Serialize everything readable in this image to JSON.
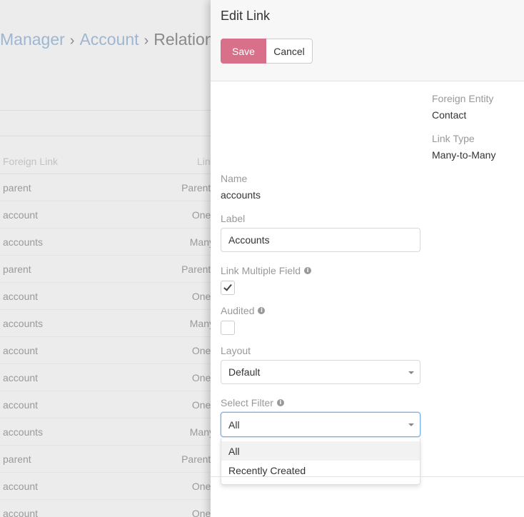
{
  "background": {
    "breadcrumb": {
      "manager": "Manager",
      "account": "Account",
      "current": "Relation",
      "separator": "›"
    },
    "table": {
      "headers": [
        "Foreign Link",
        "Lin"
      ],
      "rows": [
        [
          "parent",
          "Parent-"
        ],
        [
          "account",
          "One-"
        ],
        [
          "accounts",
          "Many"
        ],
        [
          "parent",
          "Parent-"
        ],
        [
          "account",
          "One-"
        ],
        [
          "accounts",
          "Many"
        ],
        [
          "account",
          "One-"
        ],
        [
          "account",
          "One-"
        ],
        [
          "account",
          "One-"
        ],
        [
          "accounts",
          "Many"
        ],
        [
          "parent",
          "Parent-"
        ],
        [
          "account",
          "One-"
        ],
        [
          "account",
          "One-"
        ]
      ]
    }
  },
  "modal": {
    "title": "Edit Link",
    "save_label": "Save",
    "cancel_label": "Cancel",
    "foreign_entity": {
      "label": "Foreign Entity",
      "value": "Contact"
    },
    "link_type": {
      "label": "Link Type",
      "value": "Many-to-Many"
    },
    "name": {
      "label": "Name",
      "value": "accounts"
    },
    "label_field": {
      "label": "Label",
      "value": "Accounts"
    },
    "link_multiple_field": {
      "label": "Link Multiple Field",
      "checked": true
    },
    "audited": {
      "label": "Audited",
      "checked": false
    },
    "layout": {
      "label": "Layout",
      "value": "Default"
    },
    "select_filter": {
      "label": "Select Filter",
      "value": "All",
      "options": [
        "All",
        "Recently Created"
      ]
    },
    "info_icon_glyph": "i"
  },
  "colors": {
    "accent": "#d9708b",
    "link": "#9fb6d2",
    "focus": "#7aaee6"
  }
}
